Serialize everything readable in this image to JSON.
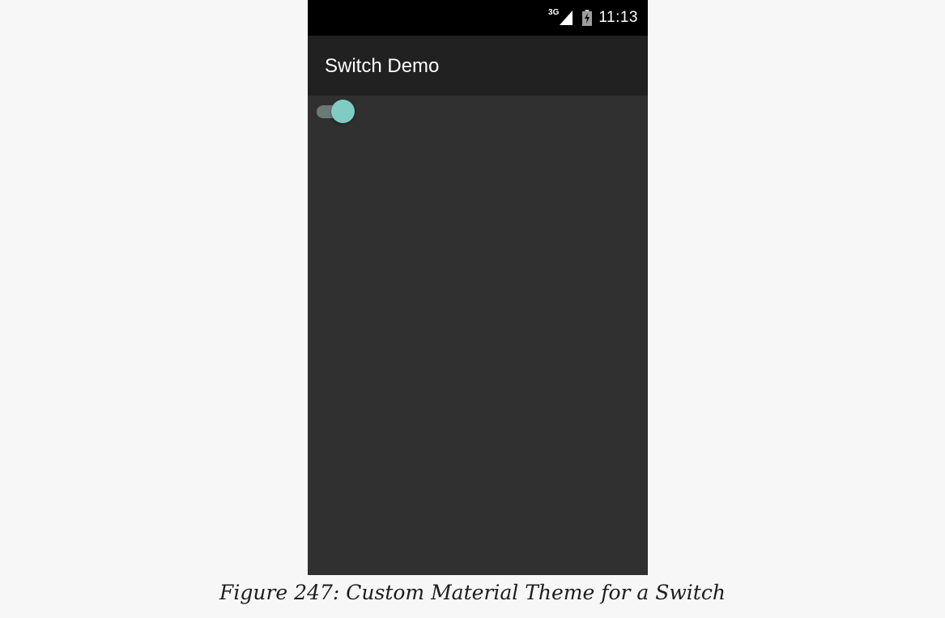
{
  "status_bar": {
    "network_type": "3G",
    "signal_icon": "cell-signal-icon",
    "battery_icon": "battery-charging-icon",
    "time": "11:13"
  },
  "app_bar": {
    "title": "Switch Demo"
  },
  "switch": {
    "state": "on",
    "thumb_color": "#80cbc4",
    "track_color": "#6b7a78"
  },
  "caption": "Figure 247: Custom Material Theme for a Switch",
  "colors": {
    "page_background": "#f7f7f7",
    "screen_background": "#303030",
    "app_bar_background": "#212121",
    "status_bar_background": "#000000"
  }
}
